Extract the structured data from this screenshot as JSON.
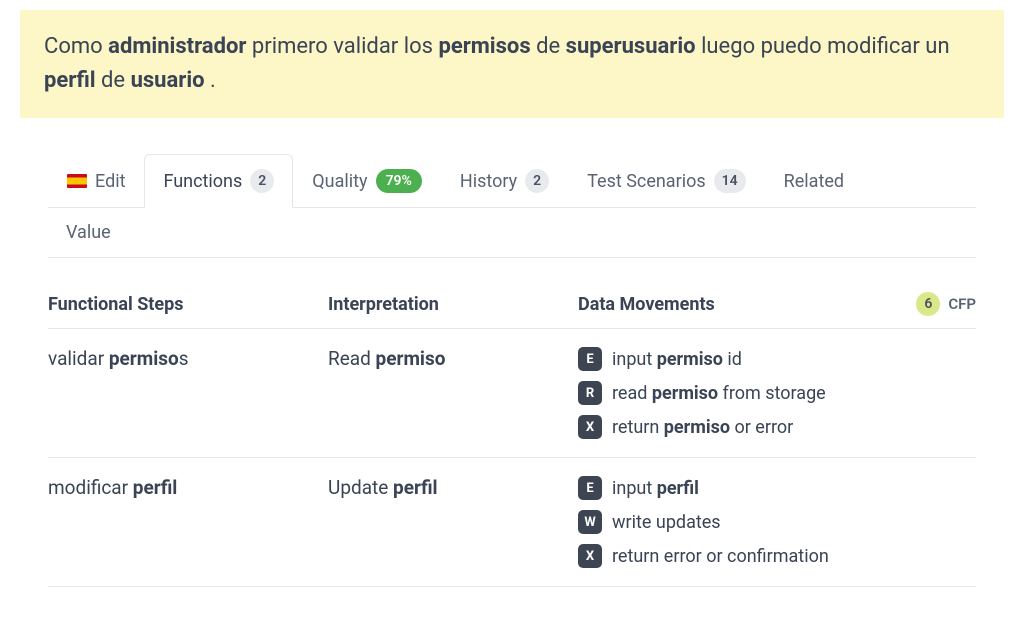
{
  "banner": {
    "seg1": "Como ",
    "bold1": "administrador",
    "seg2": " primero validar los ",
    "bold2": "permisos",
    "seg3": " de ",
    "bold3": "superusuario",
    "seg4": " luego puedo modificar un ",
    "bold4": "perfil",
    "seg5": " de ",
    "bold5": "usuario",
    "seg6": " ."
  },
  "tabs": {
    "edit": "Edit",
    "functions": "Functions",
    "functions_count": "2",
    "quality": "Quality",
    "quality_pct": "79%",
    "history": "History",
    "history_count": "2",
    "test": "Test Scenarios",
    "test_count": "14",
    "related": "Related",
    "value": "Value"
  },
  "headers": {
    "fs": "Functional Steps",
    "int": "Interpretation",
    "dm": "Data Movements",
    "cfp_count": "6",
    "cfp_label": "CFP"
  },
  "rows": [
    {
      "step_plain1": "validar ",
      "step_bold": "permiso",
      "step_plain2": "s",
      "int_plain": "Read ",
      "int_bold": "permiso",
      "moves": [
        {
          "tag": "E",
          "pre": "input ",
          "bold": "permiso",
          "post": " id"
        },
        {
          "tag": "R",
          "pre": "read ",
          "bold": "permiso",
          "post": " from storage"
        },
        {
          "tag": "X",
          "pre": "return ",
          "bold": "permiso",
          "post": " or error"
        }
      ]
    },
    {
      "step_plain1": "modificar ",
      "step_bold": "perfil",
      "step_plain2": "",
      "int_plain": "Update ",
      "int_bold": "perfil",
      "moves": [
        {
          "tag": "E",
          "pre": "input ",
          "bold": "perfil",
          "post": ""
        },
        {
          "tag": "W",
          "pre": "write updates",
          "bold": "",
          "post": ""
        },
        {
          "tag": "X",
          "pre": "return error or confirmation",
          "bold": "",
          "post": ""
        }
      ]
    }
  ]
}
